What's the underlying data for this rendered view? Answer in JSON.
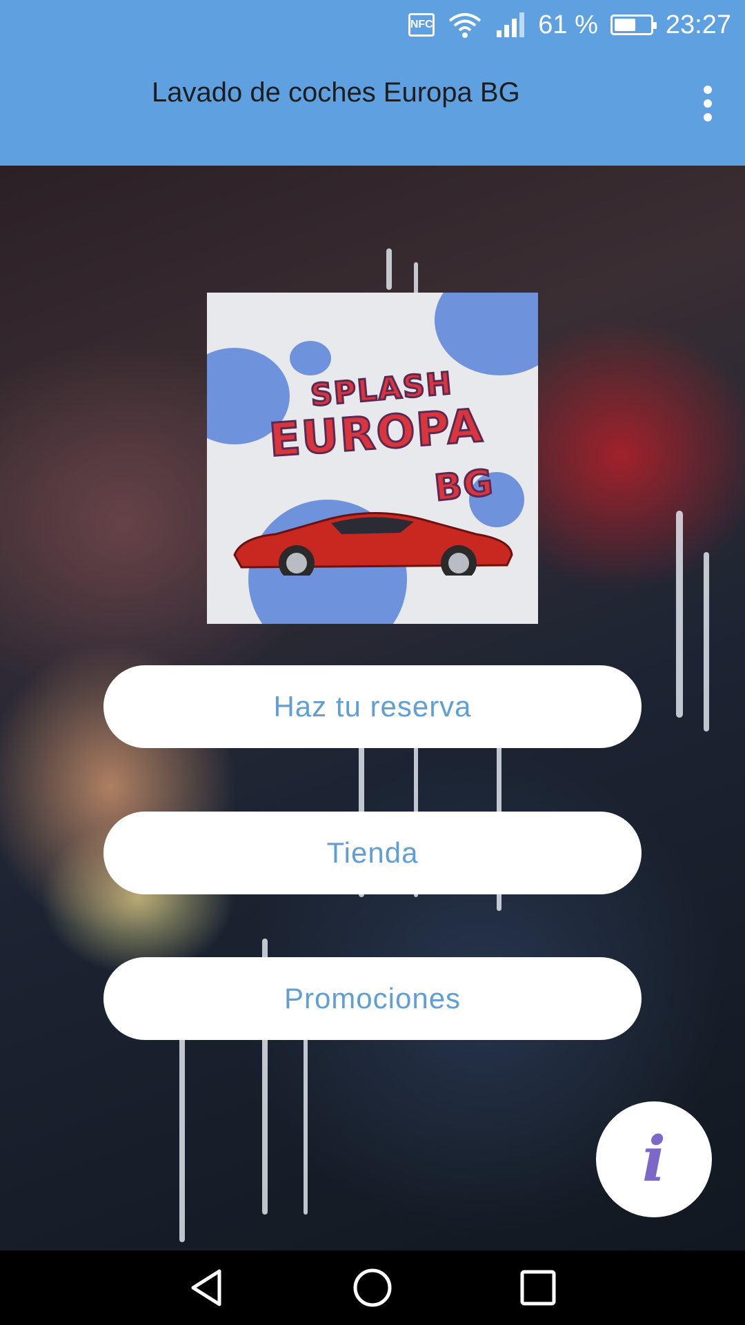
{
  "status_bar": {
    "nfc_label": "NFC",
    "battery_percent": "61 %",
    "battery_level": 0.61,
    "time": "23:27",
    "icons": [
      "nfc-icon",
      "wifi-icon",
      "signal-icon",
      "battery-icon"
    ]
  },
  "app_bar": {
    "title": "Lavado de coches Europa BG",
    "menu_icon": "more-vert-icon"
  },
  "logo": {
    "line1": "SPLASH",
    "line2": "EUROPA",
    "line3": "BG"
  },
  "buttons": {
    "reserva": "Haz tu reserva",
    "tienda": "Tienda",
    "promociones": "Promociones"
  },
  "fab": {
    "icon": "info-icon",
    "glyph": "i"
  },
  "nav_bar": {
    "icons": [
      "back-icon",
      "home-icon",
      "recents-icon"
    ]
  },
  "colors": {
    "primary": "#5fa1e0",
    "button_text": "#5f9fd6",
    "info_glyph": "#7b68c8"
  }
}
